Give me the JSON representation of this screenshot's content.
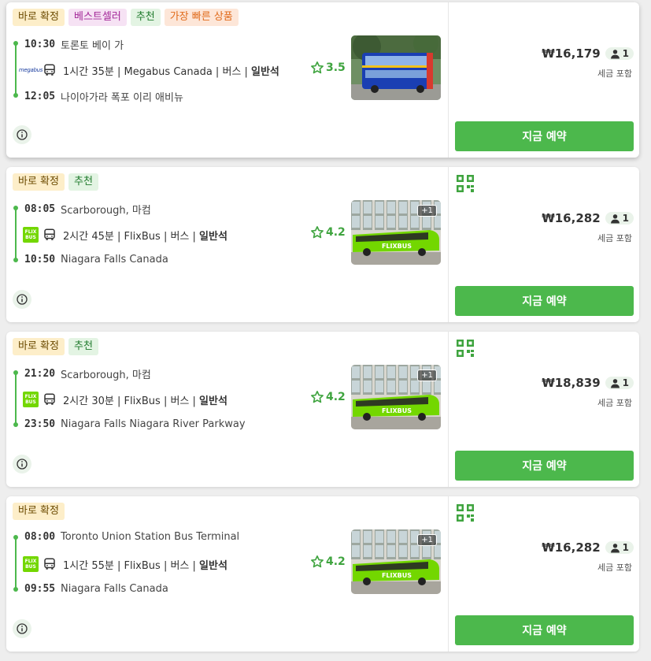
{
  "colors": {
    "accent": "#4cb84c",
    "flix_brand": "#73d700"
  },
  "results": [
    {
      "badges": [
        {
          "label": "바로 확정",
          "kind": "instant"
        },
        {
          "label": "베스트셀러",
          "kind": "best"
        },
        {
          "label": "추천",
          "kind": "rec"
        },
        {
          "label": "가장 빠른 상품",
          "kind": "fast"
        }
      ],
      "departure_time": "10:30",
      "departure_place": "토론토 베이 가",
      "arrival_time": "12:05",
      "arrival_place": "나이아가라 폭포 이리 애비뉴",
      "operator_logo": "megabus",
      "duration": "1시간 35분",
      "operator": "Megabus Canada",
      "vehicle": "버스",
      "seat_class": "일반석",
      "rating": "3.5",
      "photo_extra": "",
      "price": "₩16,179",
      "passengers": "1",
      "tax_note": "세금 포함",
      "book_label": "지금 예약"
    },
    {
      "badges": [
        {
          "label": "바로 확정",
          "kind": "instant"
        },
        {
          "label": "추천",
          "kind": "rec"
        }
      ],
      "departure_time": "08:05",
      "departure_place": "Scarborough, 마컴",
      "arrival_time": "10:50",
      "arrival_place": "Niagara Falls Canada",
      "operator_logo": "flixbus",
      "duration": "2시간 45분",
      "operator": "FlixBus",
      "vehicle": "버스",
      "seat_class": "일반석",
      "rating": "4.2",
      "photo_extra": "+1",
      "price": "₩16,282",
      "passengers": "1",
      "tax_note": "세금 포함",
      "book_label": "지금 예약"
    },
    {
      "badges": [
        {
          "label": "바로 확정",
          "kind": "instant"
        },
        {
          "label": "추천",
          "kind": "rec"
        }
      ],
      "departure_time": "21:20",
      "departure_place": "Scarborough, 마컴",
      "arrival_time": "23:50",
      "arrival_place": "Niagara Falls Niagara River Parkway",
      "operator_logo": "flixbus",
      "duration": "2시간 30분",
      "operator": "FlixBus",
      "vehicle": "버스",
      "seat_class": "일반석",
      "rating": "4.2",
      "photo_extra": "+1",
      "price": "₩18,839",
      "passengers": "1",
      "tax_note": "세금 포함",
      "book_label": "지금 예약"
    },
    {
      "badges": [
        {
          "label": "바로 확정",
          "kind": "instant"
        }
      ],
      "departure_time": "08:00",
      "departure_place": "Toronto Union Station Bus Terminal",
      "arrival_time": "09:55",
      "arrival_place": "Niagara Falls Canada",
      "operator_logo": "flixbus",
      "duration": "1시간 55분",
      "operator": "FlixBus",
      "vehicle": "버스",
      "seat_class": "일반석",
      "rating": "4.2",
      "photo_extra": "+1",
      "price": "₩16,282",
      "passengers": "1",
      "tax_note": "세금 포함",
      "book_label": "지금 예약"
    }
  ],
  "logos": {
    "megabus": "megabus",
    "flix_line1": "FLIX",
    "flix_line2": "BUS",
    "flix_bus_text": "FLIXBUS"
  },
  "icons": {
    "bus": "bus-icon",
    "star": "star-icon",
    "info": "info-icon",
    "qr": "qr-code-icon",
    "person": "person-icon"
  }
}
